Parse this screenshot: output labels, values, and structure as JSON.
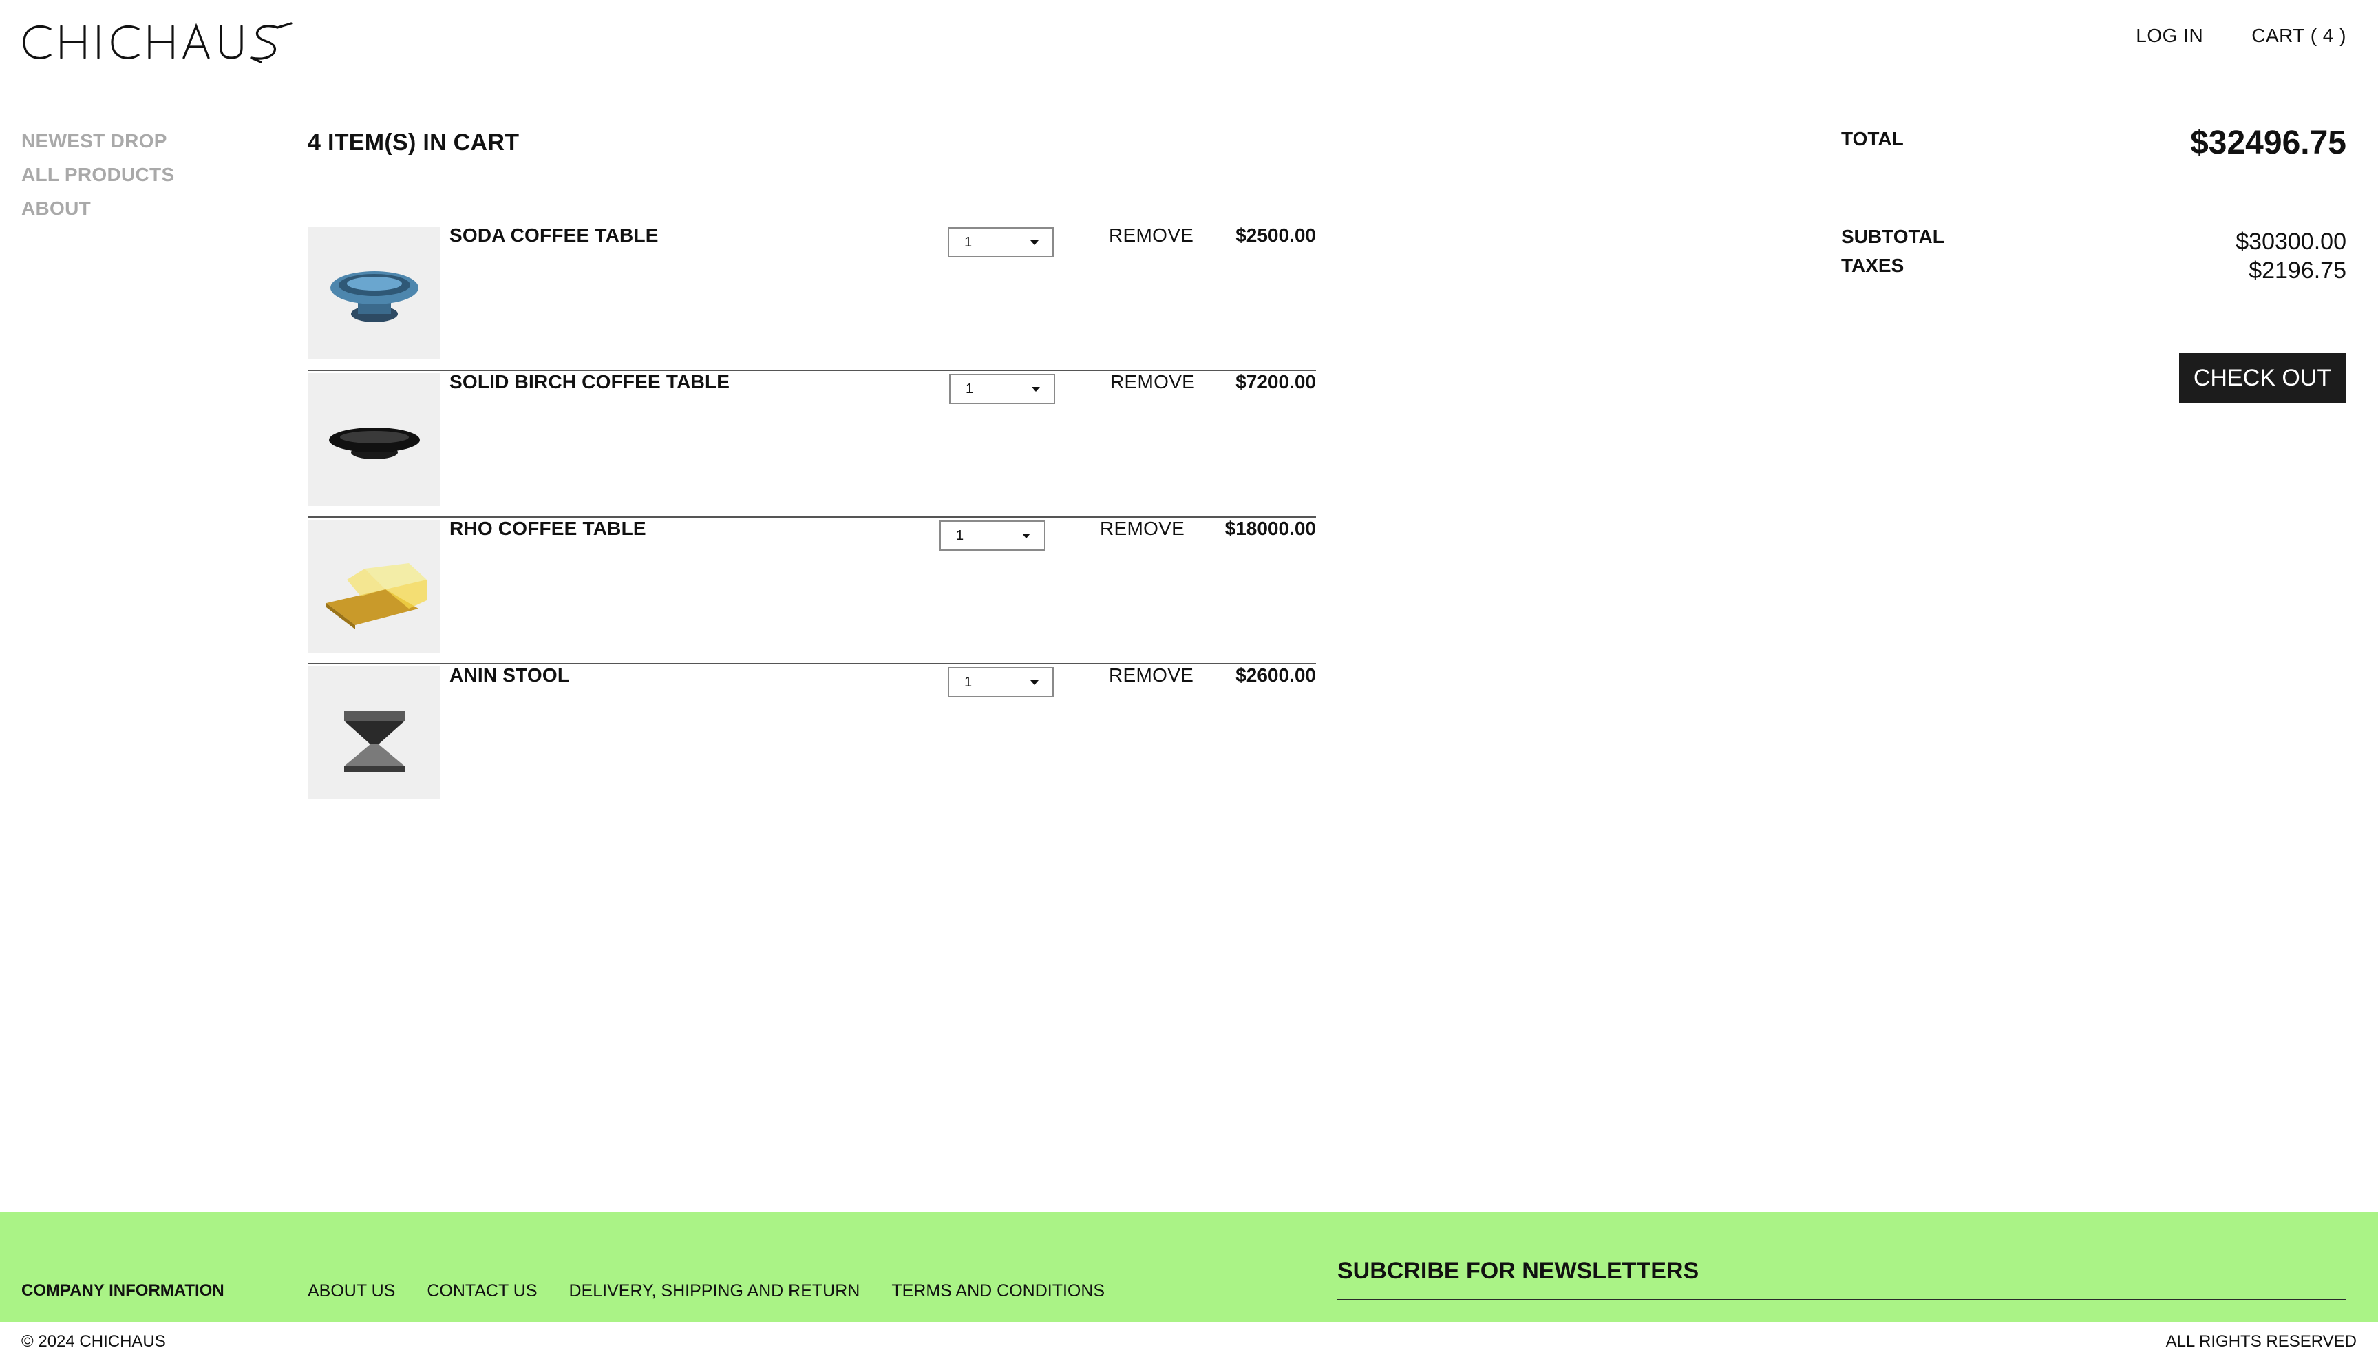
{
  "header": {
    "logo": "CHICHAUS",
    "login_label": "LOG IN",
    "cart_label": "CART ( 4 )"
  },
  "sidebar": {
    "items": [
      {
        "label": "NEWEST DROP"
      },
      {
        "label": "ALL PRODUCTS"
      },
      {
        "label": "ABOUT"
      }
    ]
  },
  "cart": {
    "heading": "4 ITEM(S) IN CART",
    "remove_label": "REMOVE",
    "items": [
      {
        "name": "SODA COFFEE TABLE",
        "quantity": "1",
        "price": "$2500.00",
        "image_icon": "blue-oval-table-icon"
      },
      {
        "name": "SOLID BIRCH COFFEE TABLE",
        "quantity": "1",
        "price": "$7200.00",
        "image_icon": "black-disc-table-icon"
      },
      {
        "name": "RHO COFFEE TABLE",
        "quantity": "1",
        "price": "$18000.00",
        "image_icon": "amber-glass-table-icon"
      },
      {
        "name": "ANIN STOOL",
        "quantity": "1",
        "price": "$2600.00",
        "image_icon": "x-stool-icon"
      }
    ]
  },
  "summary": {
    "total_label": "TOTAL",
    "total_value": "$32496.75",
    "subtotal_label": "SUBTOTAL",
    "subtotal_value": "$30300.00",
    "taxes_label": "TAXES",
    "taxes_value": "$2196.75",
    "checkout_label": "CHECK OUT"
  },
  "footer": {
    "company_label": "COMPANY INFORMATION",
    "links": [
      {
        "label": "ABOUT US"
      },
      {
        "label": "CONTACT US"
      },
      {
        "label": "DELIVERY, SHIPPING AND RETURN"
      },
      {
        "label": "TERMS AND CONDITIONS"
      }
    ],
    "newsletter_label": "SUBCRIBE FOR NEWSLETTERS",
    "copyright": "© 2024 CHICHAUS",
    "rights": "ALL RIGHTS RESERVED",
    "background_color": "#aaf386"
  }
}
